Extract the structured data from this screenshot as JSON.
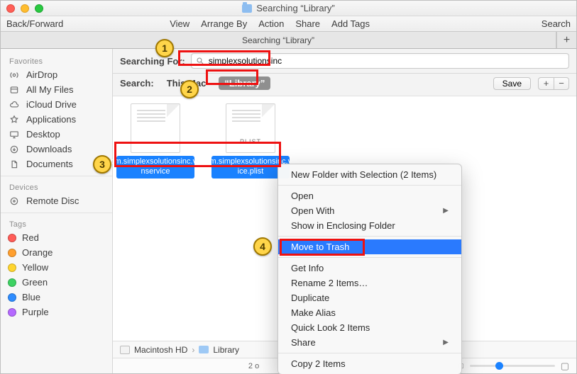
{
  "window": {
    "title": "Searching “Library”"
  },
  "toolbar": {
    "back_forward": "Back/Forward",
    "view": "View",
    "arrange_by": "Arrange By",
    "action": "Action",
    "share": "Share",
    "add_tags": "Add Tags",
    "search": "Search"
  },
  "tabbar": {
    "tab_label": "Searching “Library”",
    "add_label": "+"
  },
  "sidebar": {
    "favorites_header": "Favorites",
    "favorites": [
      {
        "label": "AirDrop"
      },
      {
        "label": "All My Files"
      },
      {
        "label": "iCloud Drive"
      },
      {
        "label": "Applications"
      },
      {
        "label": "Desktop"
      },
      {
        "label": "Downloads"
      },
      {
        "label": "Documents"
      }
    ],
    "devices_header": "Devices",
    "devices": [
      {
        "label": "Remote Disc"
      }
    ],
    "tags_header": "Tags",
    "tags": [
      {
        "label": "Red",
        "color": "#ff5c57"
      },
      {
        "label": "Orange",
        "color": "#ff9f2e"
      },
      {
        "label": "Yellow",
        "color": "#ffd52e"
      },
      {
        "label": "Green",
        "color": "#3dd262"
      },
      {
        "label": "Blue",
        "color": "#2e8cff"
      },
      {
        "label": "Purple",
        "color": "#b569ff"
      }
    ]
  },
  "search": {
    "label": "Searching For:",
    "query": "simplexsolutionsinc"
  },
  "scope": {
    "label": "Search:",
    "this_mac": "This Mac",
    "library": "“Library”",
    "selected": "library",
    "save_label": "Save",
    "plus": "+",
    "minus": "−"
  },
  "results": [
    {
      "name": "com.simplexsolutionsinc.v…nservice",
      "kind": "generic"
    },
    {
      "name": "com.simplexsolutionsinc.v…ice.plist",
      "kind": "plist",
      "badge": "PLIST"
    }
  ],
  "context_menu": {
    "items": [
      {
        "label": "New Folder with Selection (2 Items)"
      },
      {
        "sep": true
      },
      {
        "label": "Open"
      },
      {
        "label": "Open With",
        "submenu": true
      },
      {
        "label": "Show in Enclosing Folder"
      },
      {
        "sep": true
      },
      {
        "label": "Move to Trash",
        "highlight": true
      },
      {
        "sep": true
      },
      {
        "label": "Get Info"
      },
      {
        "label": "Rename 2 Items…"
      },
      {
        "label": "Duplicate"
      },
      {
        "label": "Make Alias"
      },
      {
        "label": "Quick Look 2 Items"
      },
      {
        "label": "Share",
        "submenu": true
      },
      {
        "sep": true
      },
      {
        "label": "Copy 2 Items"
      }
    ]
  },
  "pathbar": {
    "root": "Macintosh HD",
    "sep": "›",
    "folder": "Library"
  },
  "status": {
    "text_left": "2 o"
  },
  "annotations": {
    "badge1": "1",
    "badge2": "2",
    "badge3": "3",
    "badge4": "4"
  },
  "colors": {
    "highlight": "#2a7afe",
    "selection": "#1a82ff",
    "anno_red": "#e11",
    "anno_yellow": "#ffd54a"
  }
}
